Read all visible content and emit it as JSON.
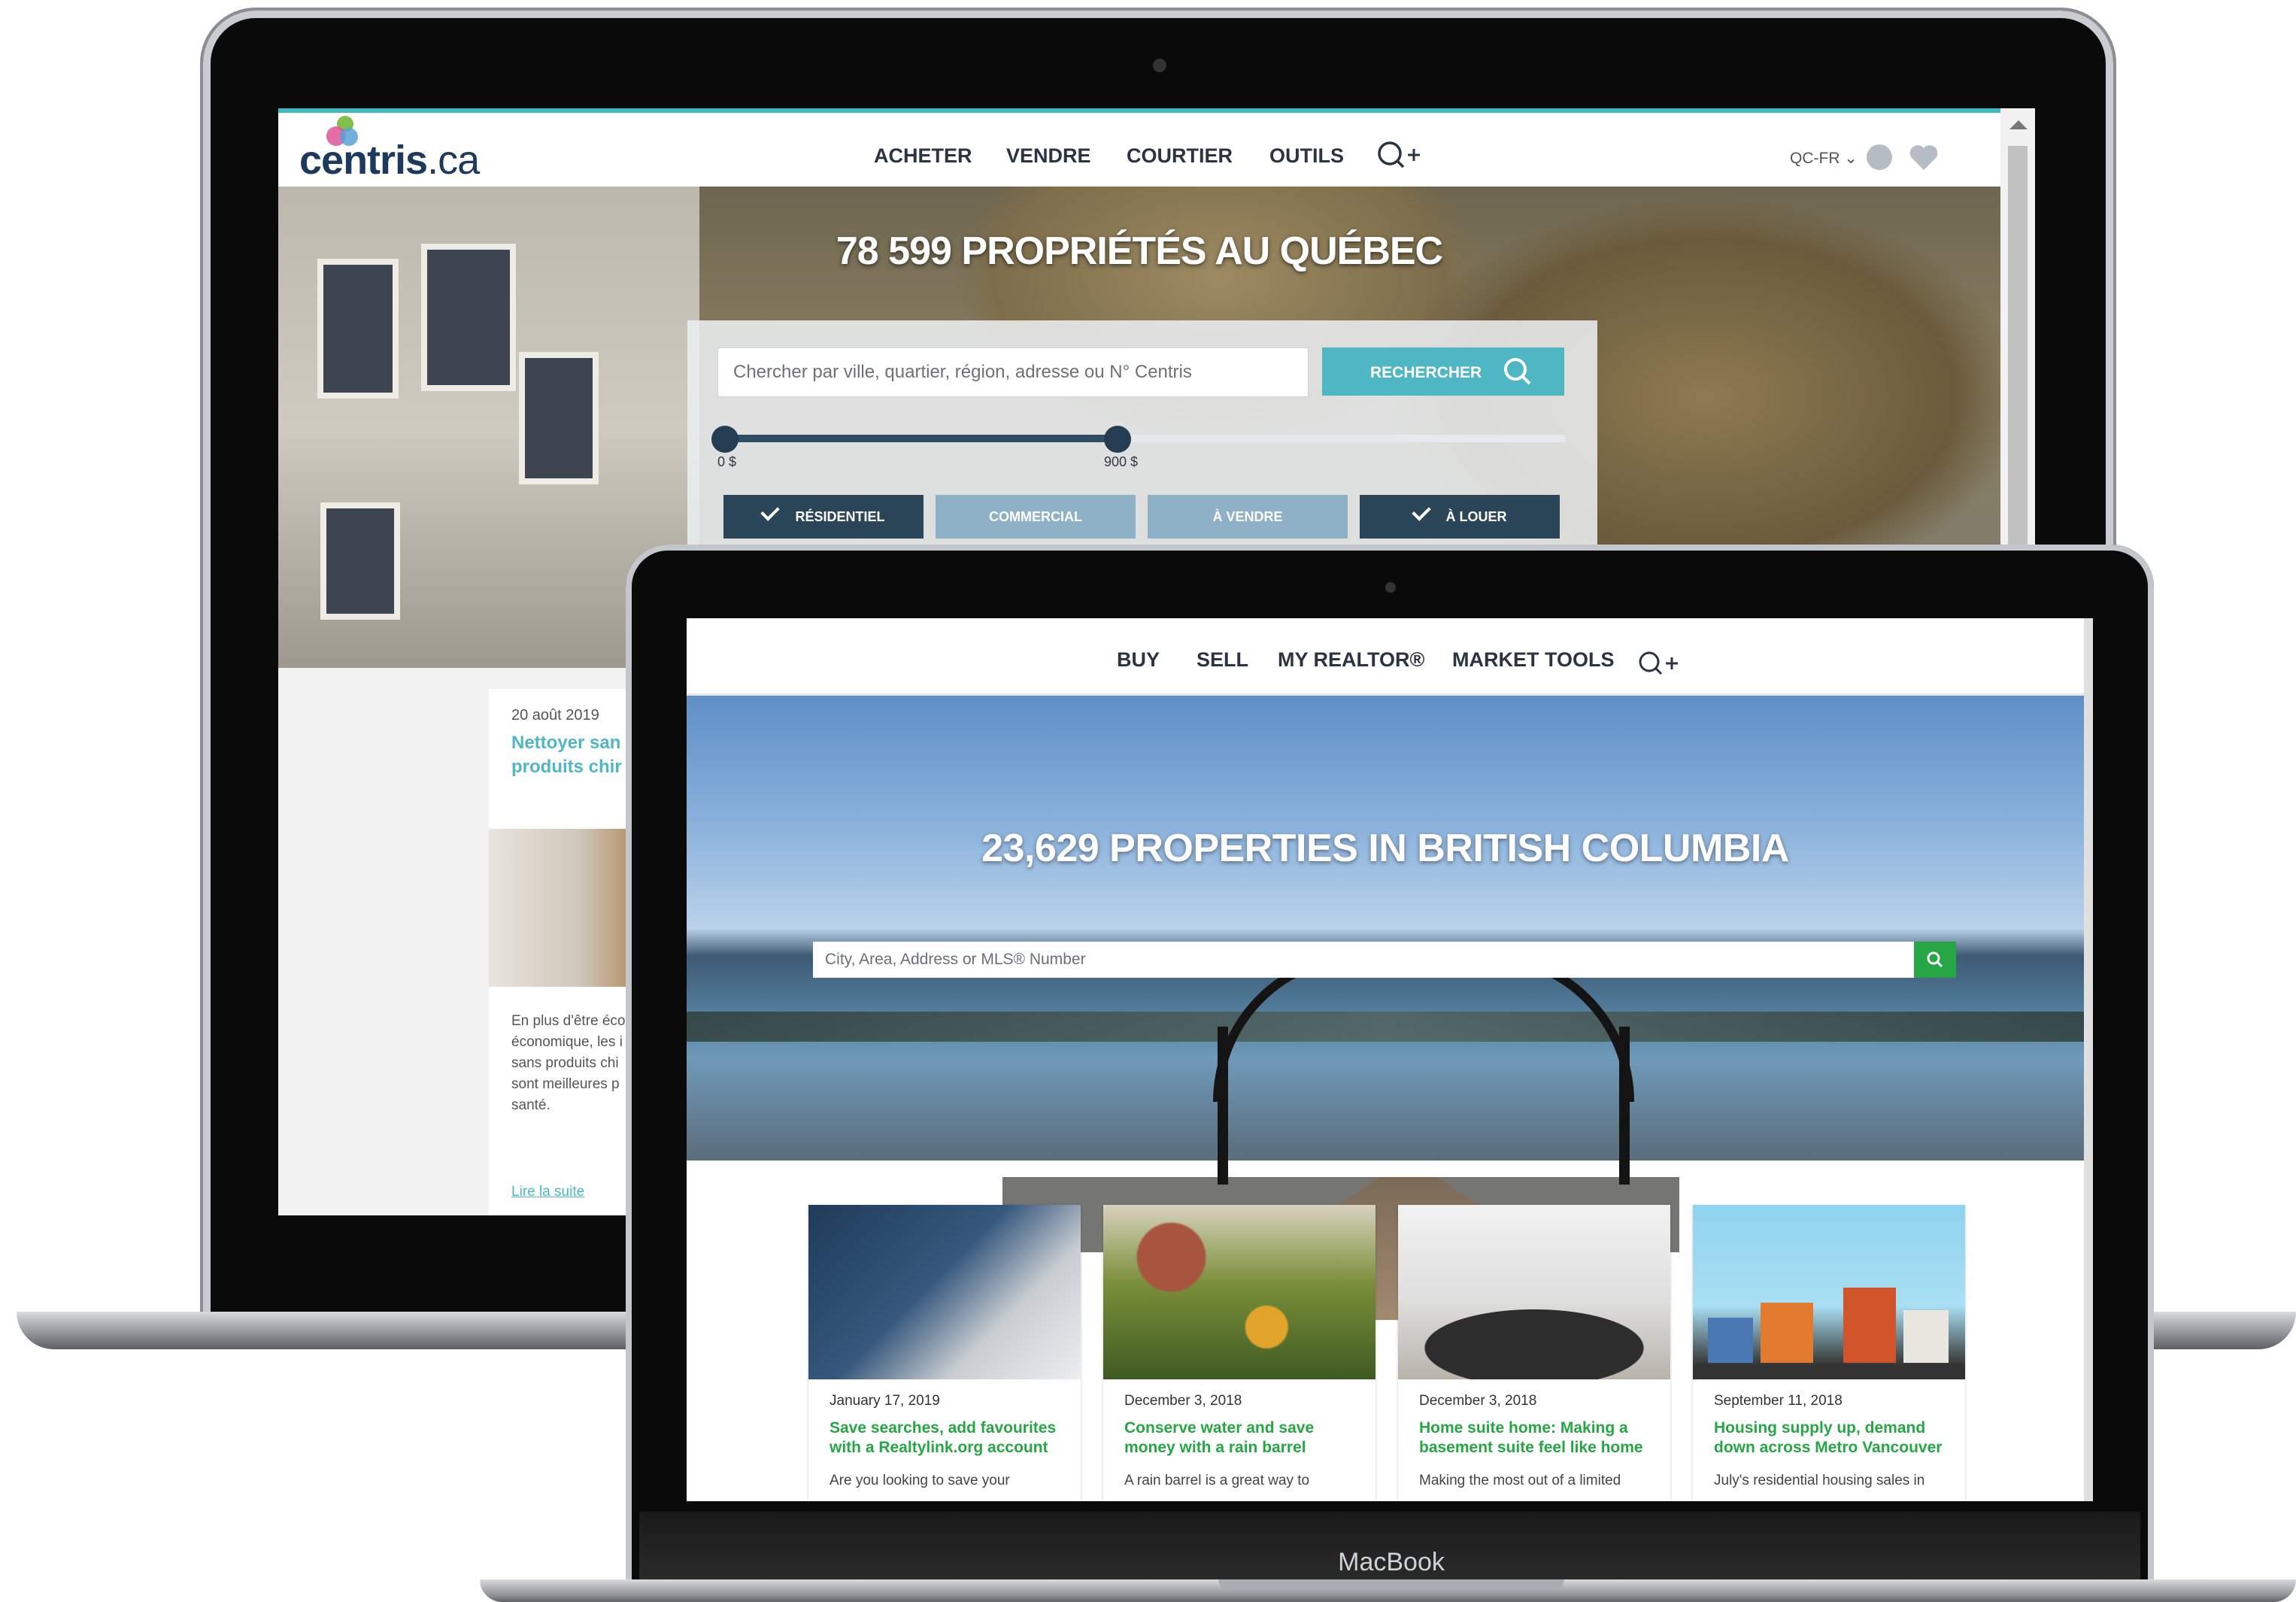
{
  "back_site": {
    "logo": {
      "brand": "centris",
      "tld": ".ca"
    },
    "nav": [
      {
        "label": "ACHETER"
      },
      {
        "label": "VENDRE"
      },
      {
        "label": "COURTIER"
      },
      {
        "label": "OUTILS"
      }
    ],
    "locale": "QC-FR ⌄",
    "hero_title": "78 599 PROPRIÉTÉS AU QUÉBEC",
    "search": {
      "placeholder": "Chercher par ville, quartier, région, adresse ou N° Centris",
      "button_label": "RECHERCHER"
    },
    "price_slider": {
      "min_label": "0 $",
      "max_label": "900 $"
    },
    "filters": [
      {
        "label": "RÉSIDENTIEL",
        "selected": true
      },
      {
        "label": "COMMERCIAL",
        "selected": false
      },
      {
        "label": "À VENDRE",
        "selected": false
      },
      {
        "label": "À LOUER",
        "selected": true
      }
    ],
    "article": {
      "date": "20 août 2019",
      "title": "Nettoyer san produits chir",
      "excerpt": "En plus d'être éco économique, les i sans produits chi sont meilleures p santé.",
      "link": "Lire la suite"
    },
    "colors": {
      "accent": "#4fb7c3",
      "dark": "#2c4659"
    }
  },
  "front_site": {
    "nav": [
      {
        "label": "BUY"
      },
      {
        "label": "SELL"
      },
      {
        "label": "MY REALTOR®"
      },
      {
        "label": "MARKET TOOLS"
      }
    ],
    "hero_title": "23,629 PROPERTIES IN BRITISH COLUMBIA",
    "search": {
      "placeholder": "City, Area, Address or MLS® Number"
    },
    "cards": [
      {
        "date": "January 17, 2019",
        "title": "Save searches, add favourites with a Realtylink.org account",
        "excerpt": "Are you looking to save your"
      },
      {
        "date": "December 3, 2018",
        "title": "Conserve water and save money with a rain barrel",
        "excerpt": "A rain barrel is a great way to"
      },
      {
        "date": "December 3, 2018",
        "title": "Home suite home: Making a basement suite feel like home",
        "excerpt": "Making the most out of a limited"
      },
      {
        "date": "September 11, 2018",
        "title": "Housing supply up, demand down across Metro Vancouver",
        "excerpt": "July's residential housing sales in"
      }
    ],
    "colors": {
      "accent": "#27a645"
    }
  },
  "device": {
    "brand": "MacBook"
  }
}
